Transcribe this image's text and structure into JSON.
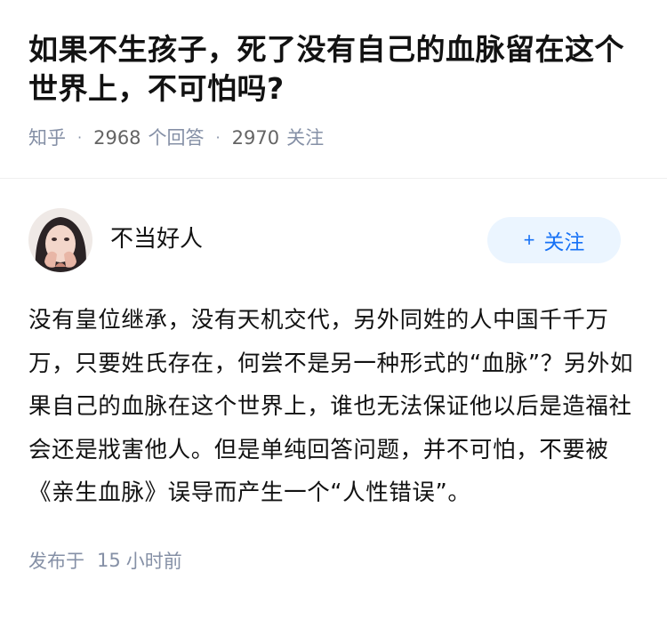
{
  "question": {
    "title": "如果不生孩子，死了没有自己的血脉留在这个世界上，不可怕吗?",
    "source": "知乎",
    "answer_count": "2968",
    "answer_label": "个回答",
    "follower_count": "2970",
    "follower_label": "关注"
  },
  "answer": {
    "author_name": "不当好人",
    "follow_label": "关注",
    "follow_plus": "+",
    "content": "没有皇位继承，没有天机交代，另外同姓的人中国千千万万，只要姓氏存在，何尝不是另一种形式的“血脉”？另外如果自己的血脉在这个世界上，谁也无法保证他以后是造福社会还是戕害他人。但是单纯回答问题，并不可怕，不要被《亲生血脉》误导而产生一个“人性错误”。",
    "published_prefix": "发布于",
    "published_value": "15",
    "published_unit": "小时前"
  },
  "colors": {
    "title": "#121212",
    "meta": "#8590a6",
    "follow_bg": "#ebf5ff",
    "follow_text": "#1772f6"
  },
  "icons": {
    "avatar": "user-avatar-photo"
  }
}
